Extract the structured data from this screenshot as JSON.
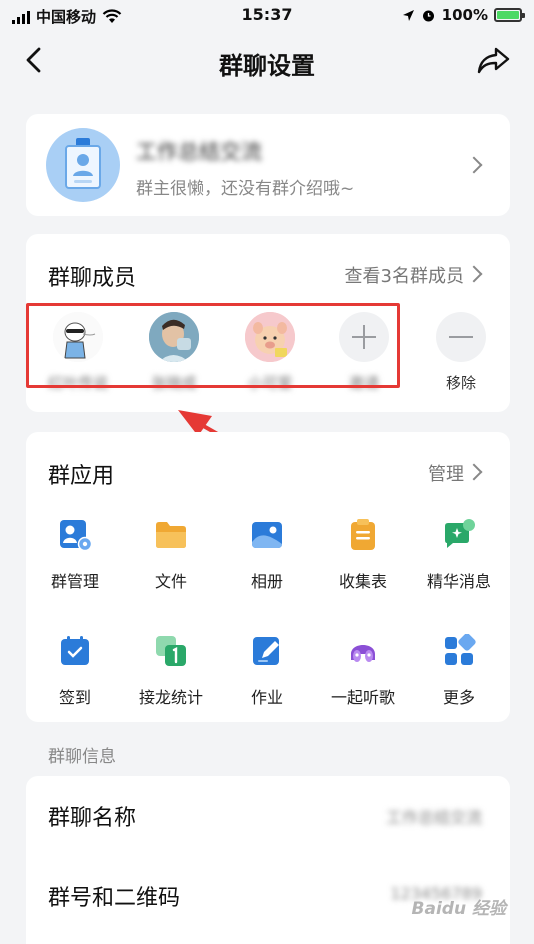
{
  "status_bar": {
    "carrier": "中国移动",
    "time": "15:37",
    "battery": "100%",
    "battery_level": 1.0
  },
  "nav": {
    "title": "群聊设置"
  },
  "group": {
    "name": "工作总结交流",
    "description": "群主很懒，还没有群介绍哦~"
  },
  "members": {
    "title": "群聊成员",
    "view_all": "查看3名群成员",
    "list": [
      {
        "label": "红叶传说"
      },
      {
        "label": "张晓成"
      },
      {
        "label": "小可爱"
      }
    ],
    "invite_label": "邀请",
    "remove_label": "移除"
  },
  "apps": {
    "title": "群应用",
    "manage": "管理",
    "items": [
      {
        "label": "群管理",
        "icon": "group-manage-icon"
      },
      {
        "label": "文件",
        "icon": "folder-icon"
      },
      {
        "label": "相册",
        "icon": "album-icon"
      },
      {
        "label": "收集表",
        "icon": "clipboard-icon"
      },
      {
        "label": "精华消息",
        "icon": "featured-message-icon"
      },
      {
        "label": "签到",
        "icon": "check-in-icon"
      },
      {
        "label": "接龙统计",
        "icon": "relay-stats-icon"
      },
      {
        "label": "作业",
        "icon": "homework-icon"
      },
      {
        "label": "一起听歌",
        "icon": "listen-together-icon"
      },
      {
        "label": "更多",
        "icon": "more-apps-icon"
      }
    ]
  },
  "info": {
    "section_label": "群聊信息",
    "rows": [
      {
        "title": "群聊名称",
        "value": "工作总结交流"
      },
      {
        "title": "群号和二维码",
        "value": "123456789"
      }
    ]
  },
  "watermark": "Baidu 经验"
}
